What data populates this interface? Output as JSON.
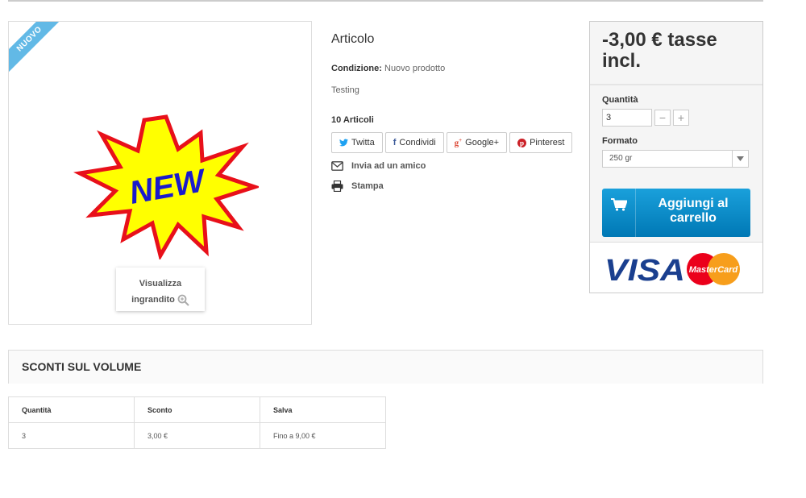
{
  "image": {
    "ribbon_label": "NUOVO",
    "picture_text": "NEW",
    "zoom_line1": "Visualizza",
    "zoom_line2": "ingrandito"
  },
  "product": {
    "title": "Articolo",
    "condition_label": "Condizione:",
    "condition_value": "Nuovo prodotto",
    "description": "Testing",
    "stock": "10 Articoli"
  },
  "share": [
    {
      "label": "Twitta",
      "icon": "twitter-icon",
      "color": "#1da1f2"
    },
    {
      "label": "Condividi",
      "icon": "facebook-icon",
      "color": "#3b5998"
    },
    {
      "label": "Google+",
      "icon": "google-plus-icon",
      "color": "#dd4b39"
    },
    {
      "label": "Pinterest",
      "icon": "pinterest-icon",
      "color": "#cb2027"
    }
  ],
  "actions": {
    "send_friend": "Invia ad un amico",
    "print": "Stampa"
  },
  "buy": {
    "price": "-3,00 € tasse incl.",
    "quantity_label": "Quantità",
    "quantity_value": "3",
    "minus": "−",
    "plus": "+",
    "format_label": "Formato",
    "format_value": "250 gr",
    "cart_label": "Aggiungi al carrello",
    "accent": "#0e8fcc"
  },
  "payment": {
    "visa": "VISA",
    "mastercard": "MasterCard"
  },
  "volume_discounts": {
    "title": "SCONTI SUL VOLUME",
    "headers": [
      "Quantità",
      "Sconto",
      "Salva"
    ],
    "rows": [
      [
        "3",
        "3,00 €",
        "Fino a 9,00 €"
      ]
    ]
  }
}
